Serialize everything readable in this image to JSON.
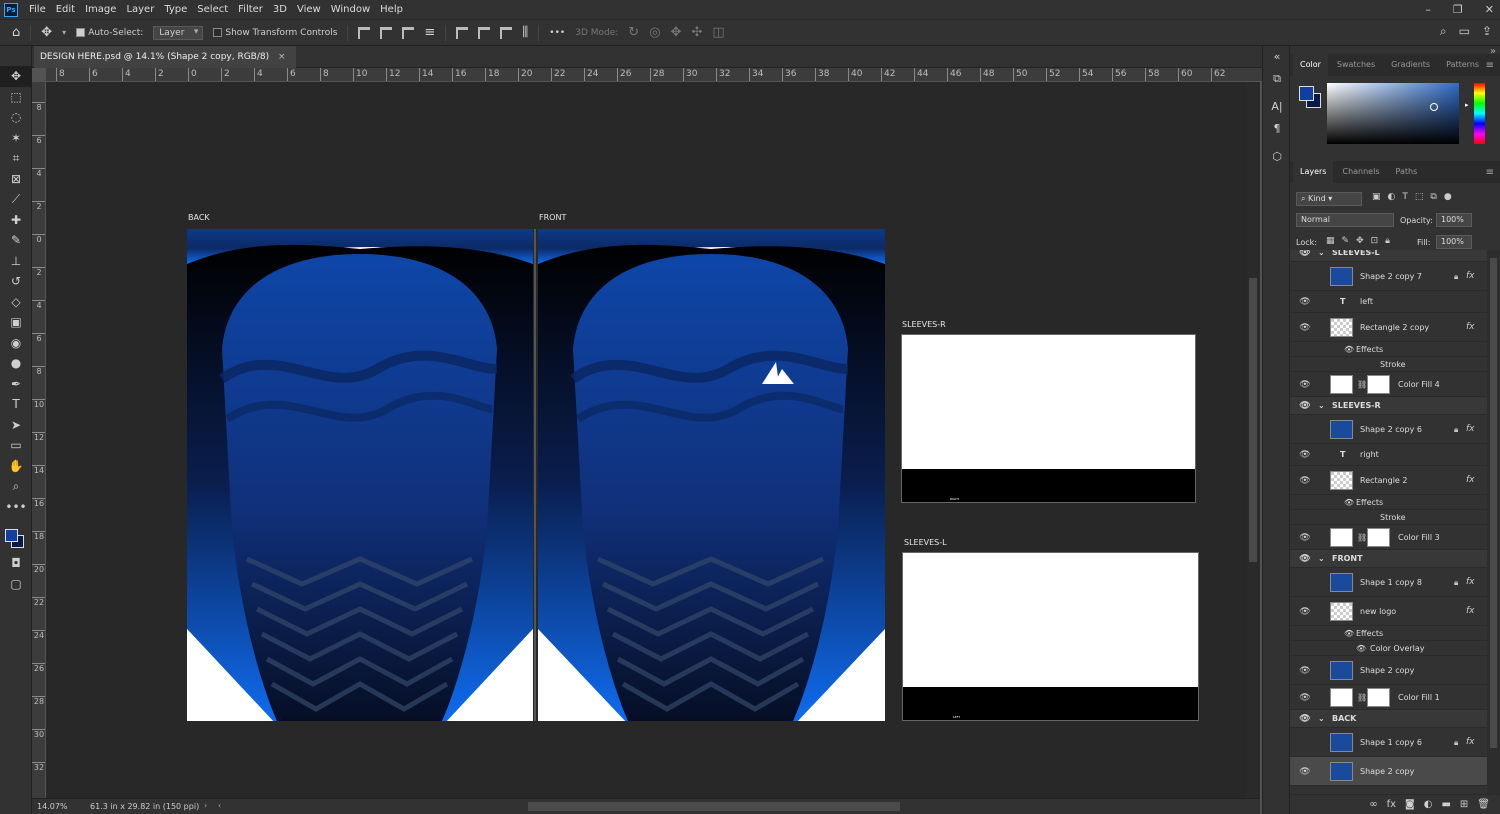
{
  "app": {
    "logo_text": "Ps"
  },
  "menu": [
    "File",
    "Edit",
    "Image",
    "Layer",
    "Type",
    "Select",
    "Filter",
    "3D",
    "View",
    "Window",
    "Help"
  ],
  "window_controls": {
    "minimize": "–",
    "restore": "❐",
    "close": "✕"
  },
  "options_bar": {
    "auto_select_label": "Auto-Select:",
    "auto_select_target": "Layer",
    "show_transform_label": "Show Transform Controls",
    "mode_3d_label": "3D Mode:",
    "more": "•••"
  },
  "document": {
    "tab_title": "DESIGN HERE.psd @ 14.1% (Shape 2 copy, RGB/8)",
    "tab_close": "×",
    "zoom": "14.07%",
    "doc_info": "61.3 in x 29.82 in (150 ppi)"
  },
  "ruler_h": [
    "8",
    "6",
    "4",
    "2",
    "0",
    "2",
    "4",
    "6",
    "8",
    "10",
    "12",
    "14",
    "16",
    "18",
    "20",
    "22",
    "24",
    "26",
    "28",
    "30",
    "32",
    "34",
    "36",
    "38",
    "40",
    "42",
    "44",
    "46",
    "48",
    "50",
    "52",
    "54",
    "56",
    "58",
    "60",
    "62"
  ],
  "ruler_v": [
    "8",
    "6",
    "4",
    "2",
    "0",
    "2",
    "4",
    "6",
    "8",
    "10",
    "12",
    "14",
    "16",
    "18",
    "20",
    "22",
    "24",
    "26",
    "28",
    "30",
    "32"
  ],
  "artboards": {
    "back": "BACK",
    "front": "FRONT",
    "sleeves_r": "SLEEVES-R",
    "sleeves_l": "SLEEVES-L",
    "sleeve_r_text": "RIGHT",
    "sleeve_l_text": "LEFT"
  },
  "colors": {
    "jersey_top": "#0b3a8a",
    "jersey_mid": "#0c2a66",
    "jersey_dark": "#06102a",
    "jersey_bright": "#0f6cf0",
    "foreground": "#0f3fa0",
    "background": "#081a45"
  },
  "right_panel": {
    "color_tabs": [
      "Color",
      "Swatches",
      "Gradients",
      "Patterns"
    ],
    "layer_tabs": [
      "Layers",
      "Channels",
      "Paths"
    ],
    "kind_label": "Kind",
    "blend_mode": "Normal",
    "opacity_label": "Opacity:",
    "opacity_value": "100%",
    "lock_label": "Lock:",
    "fill_label": "Fill:",
    "fill_value": "100%"
  },
  "layers": [
    {
      "name": "SLEEVES-L",
      "kind": "group"
    },
    {
      "name": "Shape 2 copy 7",
      "kind": "layer",
      "visible": false,
      "locked": true,
      "fx": true
    },
    {
      "name": "left",
      "kind": "text",
      "visible": true
    },
    {
      "name": "Rectangle 2 copy",
      "kind": "layer",
      "visible": true,
      "fx": true
    },
    {
      "name": "Effects",
      "kind": "effects"
    },
    {
      "name": "Stroke",
      "kind": "effect"
    },
    {
      "name": "Color Fill 4",
      "kind": "fill",
      "visible": true
    },
    {
      "name": "SLEEVES-R",
      "kind": "group"
    },
    {
      "name": "Shape 2 copy 6",
      "kind": "layer",
      "visible": false,
      "locked": true,
      "fx": true
    },
    {
      "name": "right",
      "kind": "text",
      "visible": true
    },
    {
      "name": "Rectangle 2",
      "kind": "layer",
      "visible": true,
      "fx": true
    },
    {
      "name": "Effects",
      "kind": "effects"
    },
    {
      "name": "Stroke",
      "kind": "effect"
    },
    {
      "name": "Color Fill 3",
      "kind": "fill",
      "visible": true
    },
    {
      "name": "FRONT",
      "kind": "group"
    },
    {
      "name": "Shape 1 copy 8",
      "kind": "layer",
      "visible": false,
      "locked": true,
      "fx": true
    },
    {
      "name": "new logo",
      "kind": "layer",
      "visible": true,
      "fx": true
    },
    {
      "name": "Effects",
      "kind": "effects"
    },
    {
      "name": "Color Overlay",
      "kind": "effect"
    },
    {
      "name": "Shape 2 copy",
      "kind": "layer",
      "visible": true
    },
    {
      "name": "Color Fill 1",
      "kind": "fill",
      "visible": true
    },
    {
      "name": "BACK",
      "kind": "group"
    },
    {
      "name": "Shape 1 copy 6",
      "kind": "layer",
      "visible": false,
      "locked": true,
      "fx": true
    },
    {
      "name": "Shape 2 copy",
      "kind": "layer",
      "visible": true,
      "selected": true
    }
  ]
}
